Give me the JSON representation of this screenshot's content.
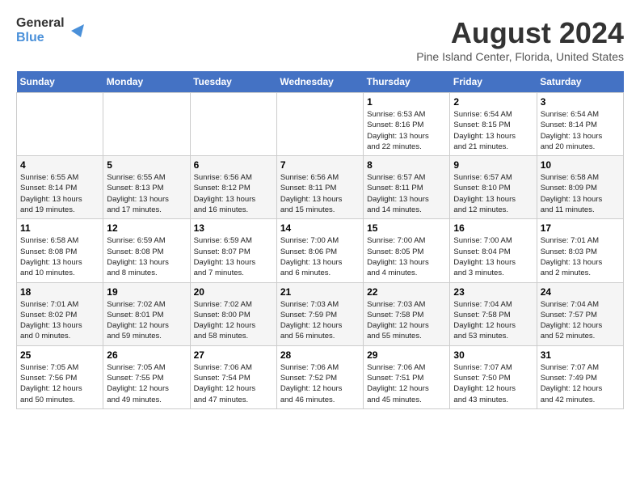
{
  "logo": {
    "text_general": "General",
    "text_blue": "Blue"
  },
  "title": "August 2024",
  "subtitle": "Pine Island Center, Florida, United States",
  "days_of_week": [
    "Sunday",
    "Monday",
    "Tuesday",
    "Wednesday",
    "Thursday",
    "Friday",
    "Saturday"
  ],
  "weeks": [
    [
      {
        "day": "",
        "info": ""
      },
      {
        "day": "",
        "info": ""
      },
      {
        "day": "",
        "info": ""
      },
      {
        "day": "",
        "info": ""
      },
      {
        "day": "1",
        "info": "Sunrise: 6:53 AM\nSunset: 8:16 PM\nDaylight: 13 hours\nand 22 minutes."
      },
      {
        "day": "2",
        "info": "Sunrise: 6:54 AM\nSunset: 8:15 PM\nDaylight: 13 hours\nand 21 minutes."
      },
      {
        "day": "3",
        "info": "Sunrise: 6:54 AM\nSunset: 8:14 PM\nDaylight: 13 hours\nand 20 minutes."
      }
    ],
    [
      {
        "day": "4",
        "info": "Sunrise: 6:55 AM\nSunset: 8:14 PM\nDaylight: 13 hours\nand 19 minutes."
      },
      {
        "day": "5",
        "info": "Sunrise: 6:55 AM\nSunset: 8:13 PM\nDaylight: 13 hours\nand 17 minutes."
      },
      {
        "day": "6",
        "info": "Sunrise: 6:56 AM\nSunset: 8:12 PM\nDaylight: 13 hours\nand 16 minutes."
      },
      {
        "day": "7",
        "info": "Sunrise: 6:56 AM\nSunset: 8:11 PM\nDaylight: 13 hours\nand 15 minutes."
      },
      {
        "day": "8",
        "info": "Sunrise: 6:57 AM\nSunset: 8:11 PM\nDaylight: 13 hours\nand 14 minutes."
      },
      {
        "day": "9",
        "info": "Sunrise: 6:57 AM\nSunset: 8:10 PM\nDaylight: 13 hours\nand 12 minutes."
      },
      {
        "day": "10",
        "info": "Sunrise: 6:58 AM\nSunset: 8:09 PM\nDaylight: 13 hours\nand 11 minutes."
      }
    ],
    [
      {
        "day": "11",
        "info": "Sunrise: 6:58 AM\nSunset: 8:08 PM\nDaylight: 13 hours\nand 10 minutes."
      },
      {
        "day": "12",
        "info": "Sunrise: 6:59 AM\nSunset: 8:08 PM\nDaylight: 13 hours\nand 8 minutes."
      },
      {
        "day": "13",
        "info": "Sunrise: 6:59 AM\nSunset: 8:07 PM\nDaylight: 13 hours\nand 7 minutes."
      },
      {
        "day": "14",
        "info": "Sunrise: 7:00 AM\nSunset: 8:06 PM\nDaylight: 13 hours\nand 6 minutes."
      },
      {
        "day": "15",
        "info": "Sunrise: 7:00 AM\nSunset: 8:05 PM\nDaylight: 13 hours\nand 4 minutes."
      },
      {
        "day": "16",
        "info": "Sunrise: 7:00 AM\nSunset: 8:04 PM\nDaylight: 13 hours\nand 3 minutes."
      },
      {
        "day": "17",
        "info": "Sunrise: 7:01 AM\nSunset: 8:03 PM\nDaylight: 13 hours\nand 2 minutes."
      }
    ],
    [
      {
        "day": "18",
        "info": "Sunrise: 7:01 AM\nSunset: 8:02 PM\nDaylight: 13 hours\nand 0 minutes."
      },
      {
        "day": "19",
        "info": "Sunrise: 7:02 AM\nSunset: 8:01 PM\nDaylight: 12 hours\nand 59 minutes."
      },
      {
        "day": "20",
        "info": "Sunrise: 7:02 AM\nSunset: 8:00 PM\nDaylight: 12 hours\nand 58 minutes."
      },
      {
        "day": "21",
        "info": "Sunrise: 7:03 AM\nSunset: 7:59 PM\nDaylight: 12 hours\nand 56 minutes."
      },
      {
        "day": "22",
        "info": "Sunrise: 7:03 AM\nSunset: 7:58 PM\nDaylight: 12 hours\nand 55 minutes."
      },
      {
        "day": "23",
        "info": "Sunrise: 7:04 AM\nSunset: 7:58 PM\nDaylight: 12 hours\nand 53 minutes."
      },
      {
        "day": "24",
        "info": "Sunrise: 7:04 AM\nSunset: 7:57 PM\nDaylight: 12 hours\nand 52 minutes."
      }
    ],
    [
      {
        "day": "25",
        "info": "Sunrise: 7:05 AM\nSunset: 7:56 PM\nDaylight: 12 hours\nand 50 minutes."
      },
      {
        "day": "26",
        "info": "Sunrise: 7:05 AM\nSunset: 7:55 PM\nDaylight: 12 hours\nand 49 minutes."
      },
      {
        "day": "27",
        "info": "Sunrise: 7:06 AM\nSunset: 7:54 PM\nDaylight: 12 hours\nand 47 minutes."
      },
      {
        "day": "28",
        "info": "Sunrise: 7:06 AM\nSunset: 7:52 PM\nDaylight: 12 hours\nand 46 minutes."
      },
      {
        "day": "29",
        "info": "Sunrise: 7:06 AM\nSunset: 7:51 PM\nDaylight: 12 hours\nand 45 minutes."
      },
      {
        "day": "30",
        "info": "Sunrise: 7:07 AM\nSunset: 7:50 PM\nDaylight: 12 hours\nand 43 minutes."
      },
      {
        "day": "31",
        "info": "Sunrise: 7:07 AM\nSunset: 7:49 PM\nDaylight: 12 hours\nand 42 minutes."
      }
    ]
  ]
}
